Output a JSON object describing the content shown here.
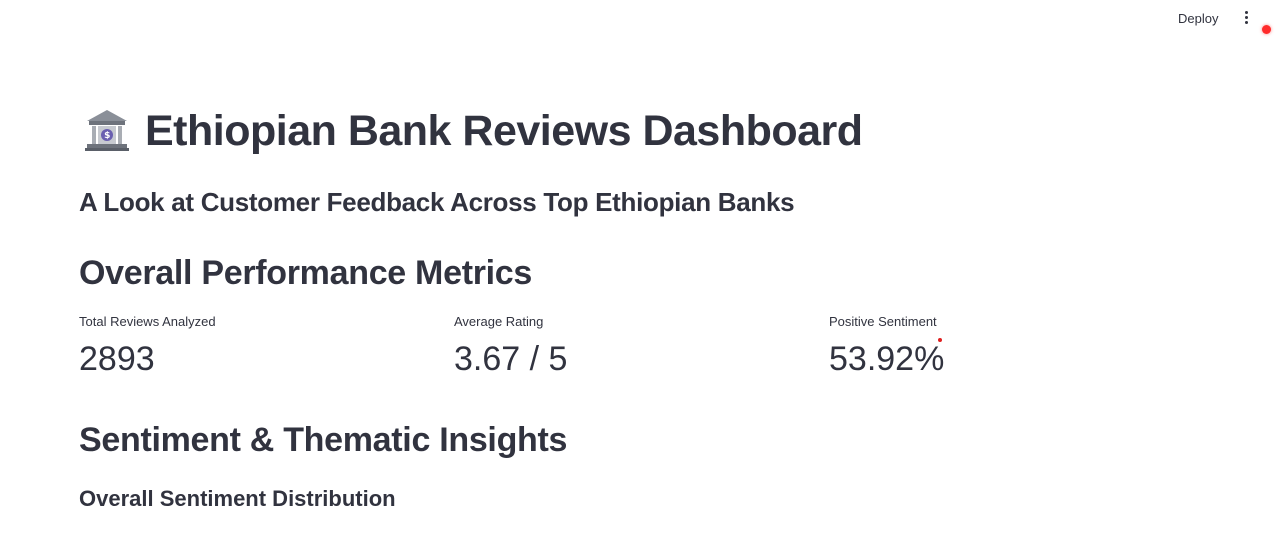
{
  "header": {
    "deploy_label": "Deploy",
    "menu_icon": "kebab-menu-icon",
    "status_color": "#ff2b2b"
  },
  "page": {
    "title_icon": "bank-icon",
    "title": "Ethiopian Bank Reviews Dashboard",
    "subtitle": "A Look at Customer Feedback Across Top Ethiopian Banks"
  },
  "metrics_section": {
    "title": "Overall Performance Metrics",
    "metrics": [
      {
        "label": "Total Reviews Analyzed",
        "value": "2893"
      },
      {
        "label": "Average Rating",
        "value": "3.67 / 5"
      },
      {
        "label": "Positive Sentiment",
        "value": "53.92%"
      }
    ]
  },
  "insights_section": {
    "title": "Sentiment & Thematic Insights",
    "subsection_title": "Overall Sentiment Distribution"
  },
  "colors": {
    "text": "#31333f",
    "background": "#ffffff",
    "accent": "#ff2b2b"
  }
}
